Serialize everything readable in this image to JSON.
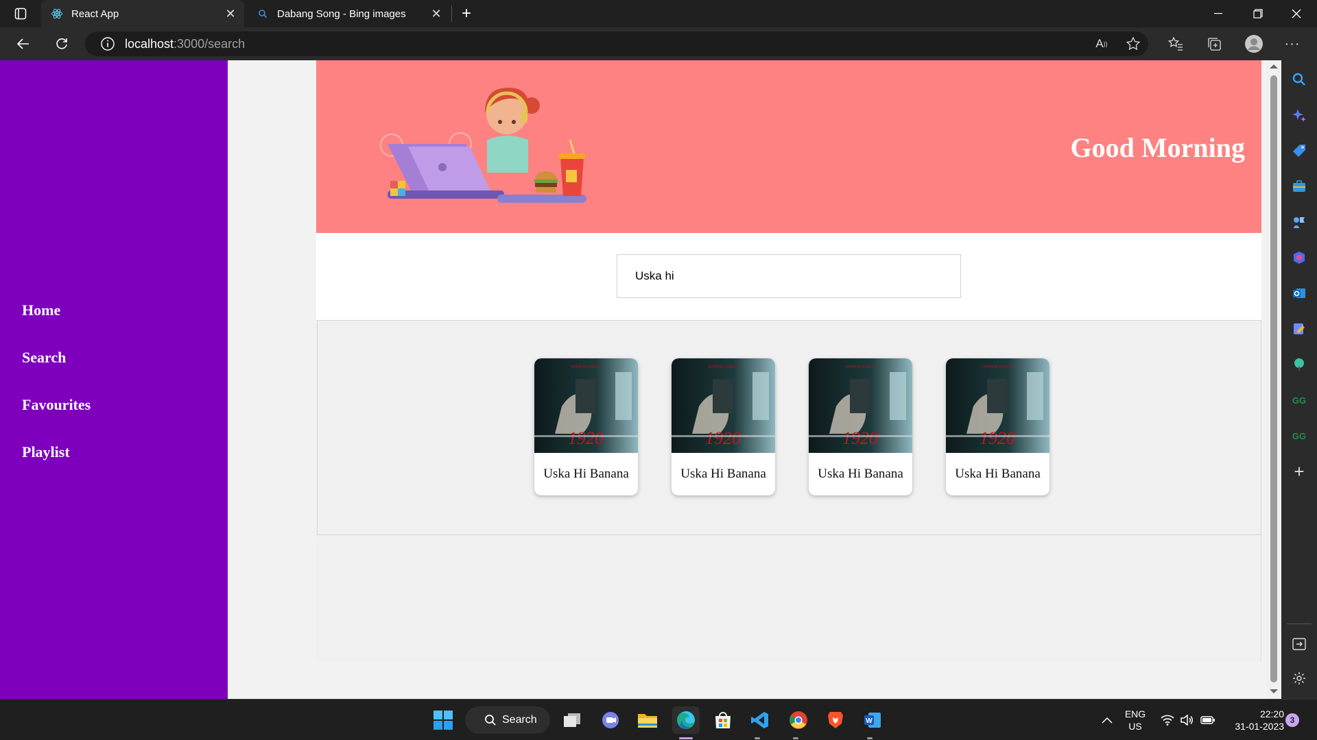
{
  "browser": {
    "tabs": [
      {
        "title": "React App"
      },
      {
        "title": "Dabang Song - Bing images"
      }
    ],
    "url_host": "localhost",
    "url_path": ":3000/search"
  },
  "sidebar": {
    "items": [
      {
        "label": "Home"
      },
      {
        "label": "Search"
      },
      {
        "label": "Favourites"
      },
      {
        "label": "Playlist"
      }
    ]
  },
  "hero": {
    "greeting": "Good Morning"
  },
  "search": {
    "value": "Uska hi"
  },
  "results": [
    {
      "title": "Uska Hi Banana"
    },
    {
      "title": "Uska Hi Banana"
    },
    {
      "title": "Uska Hi Banana"
    },
    {
      "title": "Uska Hi Banana"
    }
  ],
  "taskbar": {
    "search_label": "Search",
    "lang_line1": "ENG",
    "lang_line2": "US",
    "time": "22:20",
    "date": "31-01-2023",
    "notification_count": "3"
  },
  "colors": {
    "sidebar": "#7e00bd",
    "hero": "#fd8281"
  }
}
